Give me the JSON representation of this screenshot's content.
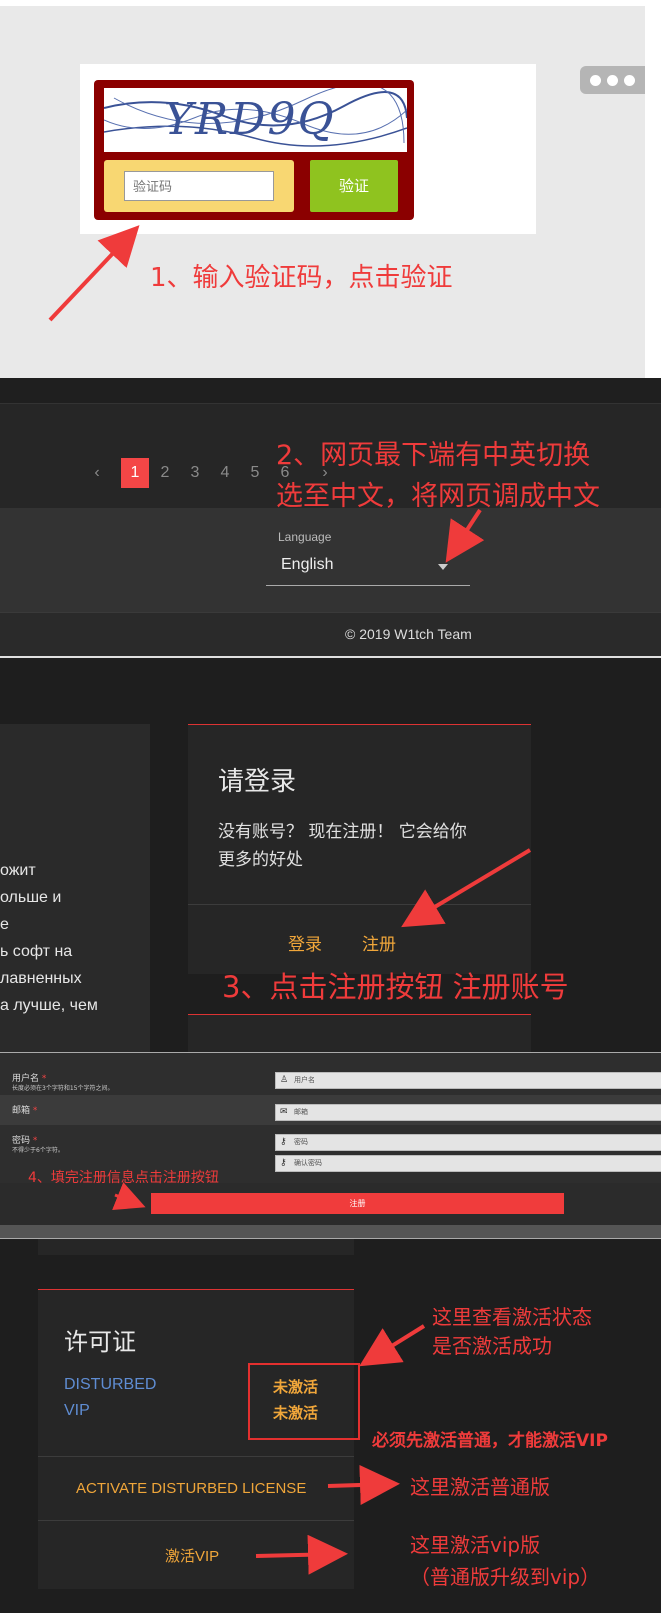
{
  "captcha": {
    "image_text": "YRD9Q",
    "input_placeholder": "验证码",
    "verify_button": "验证",
    "annotation": "1、输入验证码，点击验证"
  },
  "footer": {
    "pages": [
      "1",
      "2",
      "3",
      "4",
      "5",
      "6"
    ],
    "active_page": "1",
    "prev_symbol": "‹",
    "next_symbol": "›",
    "annotation_line1": "2、网页最下端有中英切换",
    "annotation_line2": "选至中文，将网页调成中文",
    "language_label": "Language",
    "language_value": "English",
    "copyright": "© 2019 W1tch Team"
  },
  "login": {
    "russian_lines": [
      "ожит",
      "ольше и",
      "e",
      "ь софт на",
      "лавненных",
      "а лучше, чем"
    ],
    "title": "请登录",
    "desc_line1": "没有账号？ 现在注册！ 它会给你",
    "desc_line2": "更多的好处",
    "login_link": "登录",
    "register_link": "注册",
    "annotation": "3、点击注册按钮    注册账号"
  },
  "register": {
    "username_label": "用户名",
    "username_hint": "长度必须在3个字符和15个字符之间。",
    "username_placeholder": "用户名",
    "email_label": "邮箱",
    "email_placeholder": "邮箱",
    "password_label": "密码",
    "password_hint": "不得少于6个字符。",
    "password_placeholder": "密码",
    "confirm_placeholder": "确认密码",
    "required_mark": "*",
    "annotation": "4、填完注册信息点击注册按钮",
    "register_button": "注册"
  },
  "license": {
    "title": "许可证",
    "products": [
      "DISTURBED",
      "VIP"
    ],
    "statuses": [
      "未激活",
      "未激活"
    ],
    "annotation_status_1": "这里查看激活状态",
    "annotation_status_2": "是否激活成功",
    "annotation_warning": "必须先激活普通，才能激活VIP",
    "activate_button": "ACTIVATE DISTURBED LICENSE",
    "annotation_activate": "这里激活普通版",
    "vip_button": "激活VIP",
    "annotation_vip_1": "这里激活vip版",
    "annotation_vip_2": "（普通版升级到vip）"
  },
  "colors": {
    "annotation_red": "#ef3b3b",
    "link_orange": "#f0a63a",
    "product_blue": "#5f8dd3",
    "verify_green": "#8fc31f",
    "register_red": "#f03c3c"
  }
}
